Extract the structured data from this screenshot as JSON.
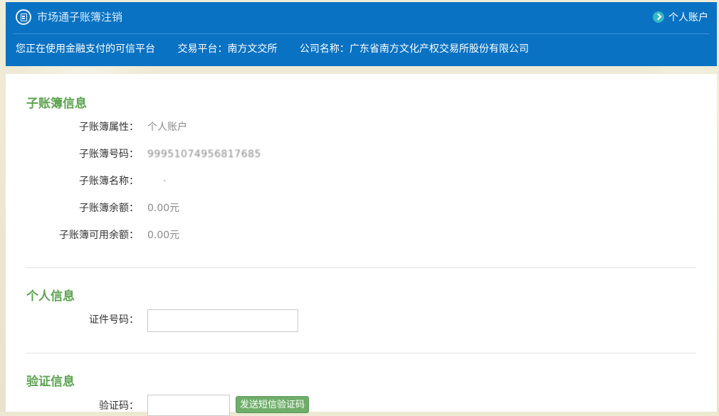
{
  "header": {
    "title": "市场通子账簿注销",
    "account_link": "个人账户",
    "info": {
      "trusted_platform": "您正在使用金融支付的可信平台",
      "trading_platform": "交易平台：南方文交所",
      "company_name": "公司名称：广东省南方文化产权交易所股份有限公司"
    }
  },
  "sub_ledger": {
    "title": "子账簿信息",
    "fields": {
      "attribute": {
        "label": "子账簿属性：",
        "value": "个人账户"
      },
      "number": {
        "label": "子账簿号码：",
        "value": "99951074956817685"
      },
      "name": {
        "label": "子账簿名称：",
        "value": "·"
      },
      "balance": {
        "label": "子账簿余额：",
        "value": "0.00元"
      },
      "available_balance": {
        "label": "子账簿可用余额：",
        "value": "0.00元"
      }
    }
  },
  "personal": {
    "title": "个人信息",
    "id_number": {
      "label": "证件号码：",
      "value": "",
      "placeholder": ""
    }
  },
  "verification": {
    "title": "验证信息",
    "code": {
      "label": "验证码：",
      "value": "",
      "placeholder": ""
    },
    "send_button": "发送短信验证码"
  },
  "colors": {
    "header_bg": "#0a72c3",
    "section_title": "#5da350",
    "button_bg": "#6fae6a"
  }
}
